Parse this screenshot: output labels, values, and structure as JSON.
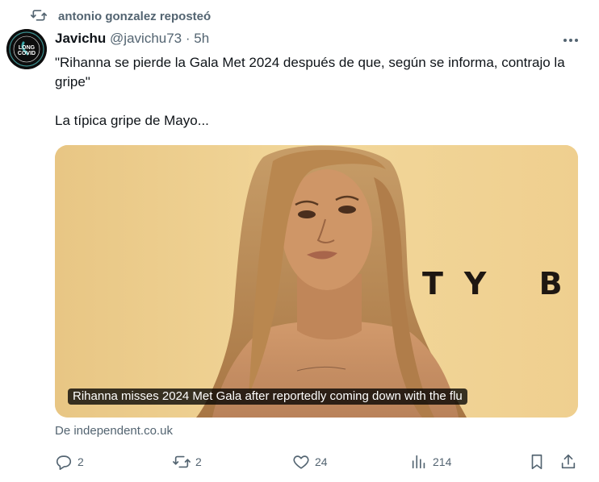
{
  "repost": {
    "icon": "repost-icon",
    "text": "antonio gonzalez reposteó"
  },
  "author": {
    "avatar_icon": "long-covid-avatar",
    "avatar_lines": [
      "LONG",
      "COVID"
    ],
    "name": "Javichu",
    "handle": "@javichu73",
    "separator": "·",
    "time": "5h"
  },
  "tweet": {
    "paragraphs": [
      "\"Rihanna se pierde la Gala Met 2024 después de que, según se informa, contrajo la gripe\"",
      "La típica gripe de Mayo..."
    ]
  },
  "media": {
    "brand_text": "TY BE",
    "caption": "Rihanna misses 2024 Met Gala after reportedly coming down with the flu",
    "source": "De independent.co.uk",
    "colors": {
      "background": "#efcf8a",
      "hair": "#b88a58",
      "skin": "#c98f62",
      "brand_text": "#1e1712"
    }
  },
  "actions": {
    "reply": {
      "icon": "reply-icon",
      "count": "2"
    },
    "repost": {
      "icon": "repost-icon",
      "count": "2"
    },
    "like": {
      "icon": "heart-icon",
      "count": "24"
    },
    "views": {
      "icon": "views-icon",
      "count": "214"
    },
    "bookmark": {
      "icon": "bookmark-icon"
    },
    "share": {
      "icon": "share-icon"
    }
  },
  "colors": {
    "text_primary": "#0f1419",
    "text_secondary": "#536471"
  }
}
